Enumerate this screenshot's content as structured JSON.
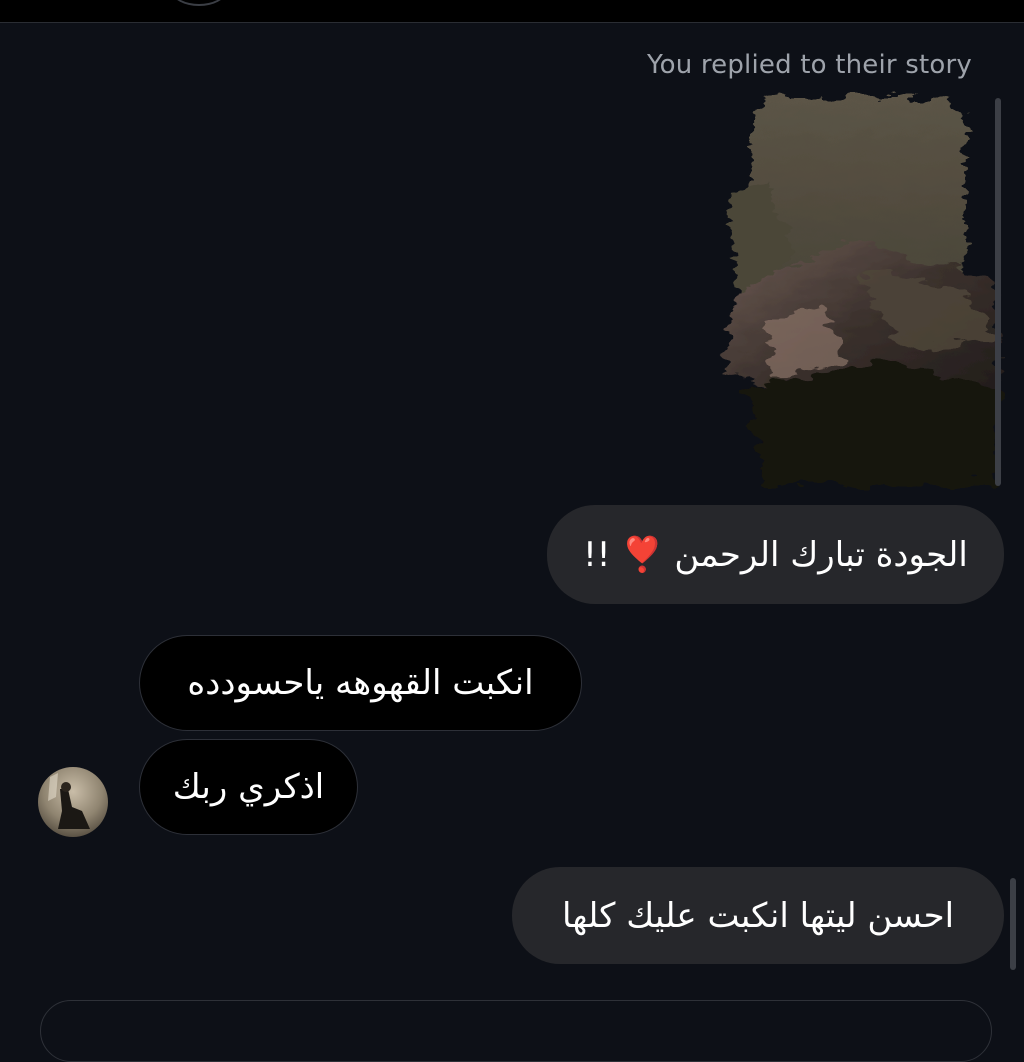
{
  "story": {
    "reply_label": "You replied to their story"
  },
  "messages": [
    {
      "direction": "sent",
      "text": "الجودة تبارك الرحمن ❣️ !!"
    },
    {
      "direction": "received",
      "text": "انكبت القهوهه ياحسودده"
    },
    {
      "direction": "received",
      "text": "اذكري ربك"
    },
    {
      "direction": "sent",
      "text": "احسن ليتها انكبت عليك كلها"
    }
  ],
  "colors": {
    "background": "#0d1017",
    "sent_bubble": "#26272b",
    "received_bubble": "#000000",
    "secondary_text": "#9ea3ab"
  }
}
